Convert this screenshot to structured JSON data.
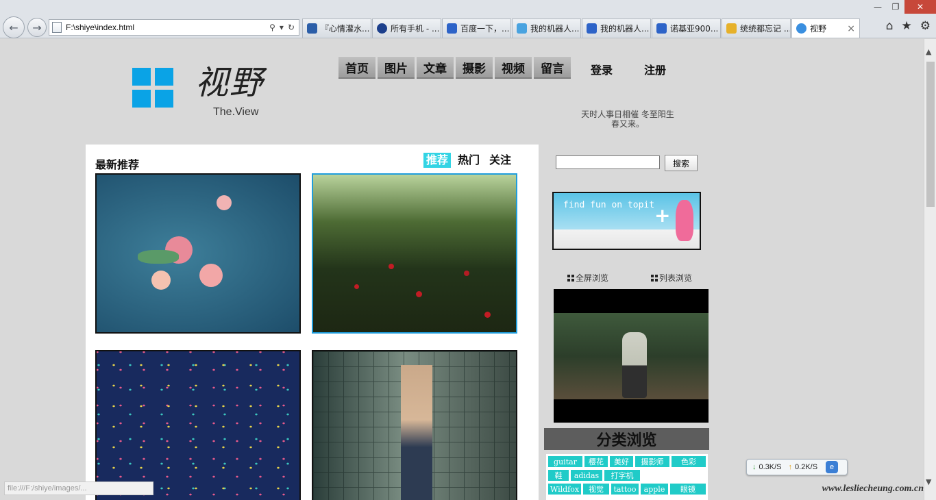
{
  "browser": {
    "address": "F:\\shiye\\index.html",
    "tabs": [
      {
        "label": "『心情灌水...",
        "color": "#2b5ea8"
      },
      {
        "label": "所有手机 - ...",
        "color": "#1c3f8c"
      },
      {
        "label": "百度一下，...",
        "color": "#2d63c8"
      },
      {
        "label": "我的机器人...",
        "color": "#49a3e0"
      },
      {
        "label": "我的机器人...",
        "color": "#2d63c8"
      },
      {
        "label": "诺基亚900...",
        "color": "#2d63c8"
      },
      {
        "label": "统统都忘记 ...",
        "color": "#e6b12a"
      },
      {
        "label": "视野",
        "color": "#3a8fe0"
      }
    ],
    "icons": [
      "back-icon",
      "forward-icon",
      "search-icon",
      "dropdown-icon",
      "refresh-icon",
      "home-icon",
      "star-icon",
      "gear-icon"
    ]
  },
  "site": {
    "logo_cn": "视野",
    "logo_en": "The.View",
    "nav": [
      "首页",
      "图片",
      "文章",
      "摄影",
      "视频",
      "留言"
    ],
    "login": "登录",
    "register": "注册",
    "motto_line1": "天时人事日相催   冬至阳生",
    "motto_line2": "春又来。",
    "accent": "#0aa3e6"
  },
  "content": {
    "title": "最新推荐",
    "filters": [
      "推荐",
      "热门",
      "关注"
    ],
    "active_filter": "推荐"
  },
  "sidebar": {
    "search_button": "搜索",
    "banner_text": "find fun on topit",
    "banner_plus": "+",
    "view_full": "全屏浏览",
    "view_list": "列表浏览",
    "category_title": "分类浏览",
    "tags": [
      "guitar",
      "樱花",
      "美好",
      "摄影师",
      "色彩",
      "鞋",
      "adidas",
      "打字机",
      "Wildfox",
      "视觉",
      "tattoo",
      "apple",
      "眼镜"
    ]
  },
  "status": {
    "url": "file:///F:/shiye/images/...",
    "down_speed": "0.3K/S",
    "up_speed": "0.2K/S",
    "watermark": "www.lesliecheung.com.cn"
  }
}
